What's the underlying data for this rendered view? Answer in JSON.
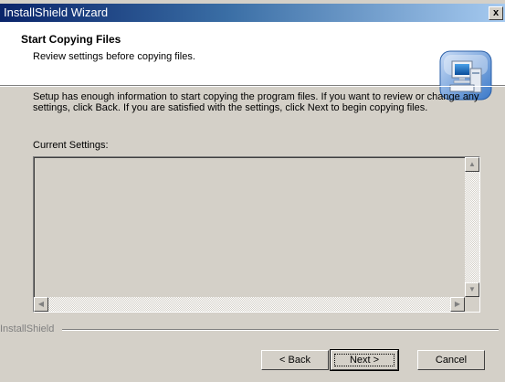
{
  "window": {
    "title": "InstallShield Wizard",
    "close_label": "x"
  },
  "header": {
    "title": "Start Copying Files",
    "subtitle": "Review settings before copying files."
  },
  "body": {
    "description": "Setup has enough information to start copying the program files.  If you want to review or change any settings, click Back.  If you are satisfied with the settings, click Next to begin copying files.",
    "settings_label": "Current Settings:",
    "settings_value": ""
  },
  "footer": {
    "brand": "InstallShield",
    "buttons": {
      "back": "< Back",
      "next": "Next >",
      "cancel": "Cancel"
    }
  },
  "colors": {
    "title_gradient_start": "#0a246a",
    "title_gradient_end": "#a6caf0",
    "dialog_face": "#d4d0c8"
  },
  "icons": {
    "header": "computer-install-icon"
  }
}
